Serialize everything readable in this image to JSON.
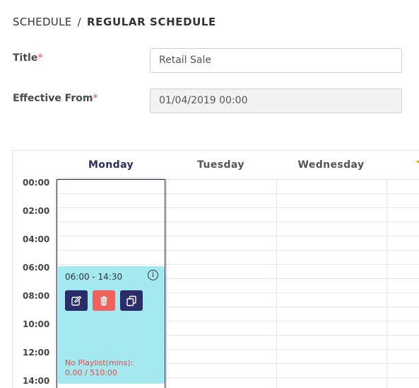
{
  "breadcrumb": {
    "parent": "SCHEDULE",
    "separator": "/",
    "current": "REGULAR SCHEDULE"
  },
  "form": {
    "title": {
      "label": "Title",
      "required_mark": "*",
      "value": "Retail Sale"
    },
    "effective_from": {
      "label": "Effective From",
      "required_mark": "*",
      "value": "01/04/2019 00:00"
    }
  },
  "calendar": {
    "days": [
      "Monday",
      "Tuesday",
      "Wednesday"
    ],
    "active_day": "Monday",
    "times": [
      "00:00",
      "02:00",
      "04:00",
      "06:00",
      "08:00",
      "10:00",
      "12:00",
      "14:00"
    ],
    "event": {
      "time_range": "06:00 - 14:30",
      "info_icon": "i",
      "warning_line1": "No Playlist(mins):",
      "warning_line2": "0.00 / 510:00",
      "buttons": [
        "edit-icon",
        "delete-icon",
        "copy-icon"
      ]
    }
  },
  "colors": {
    "event_bg": "#a3e9ef",
    "button_dark": "#2b2d6b",
    "button_delete": "#f0625e",
    "warning_text": "#e34b4b"
  }
}
